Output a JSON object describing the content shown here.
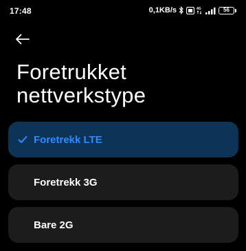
{
  "status_bar": {
    "time": "17:48",
    "network_speed": "0,1KB/s",
    "battery_level": "56",
    "icons": [
      "bluetooth-icon",
      "volte-icon",
      "mobile-data-4g-icon",
      "signal-icon"
    ]
  },
  "header": {
    "back_icon": "arrow-left-icon",
    "title": "Foretrukket nettverkstype"
  },
  "options": [
    {
      "label": "Foretrekk LTE",
      "selected": true
    },
    {
      "label": "Foretrekk 3G",
      "selected": false
    },
    {
      "label": "Bare 2G",
      "selected": false
    }
  ],
  "colors": {
    "background": "#000000",
    "card": "#1c1c1c",
    "selected_card": "#0d3357",
    "accent": "#2f8bff"
  }
}
